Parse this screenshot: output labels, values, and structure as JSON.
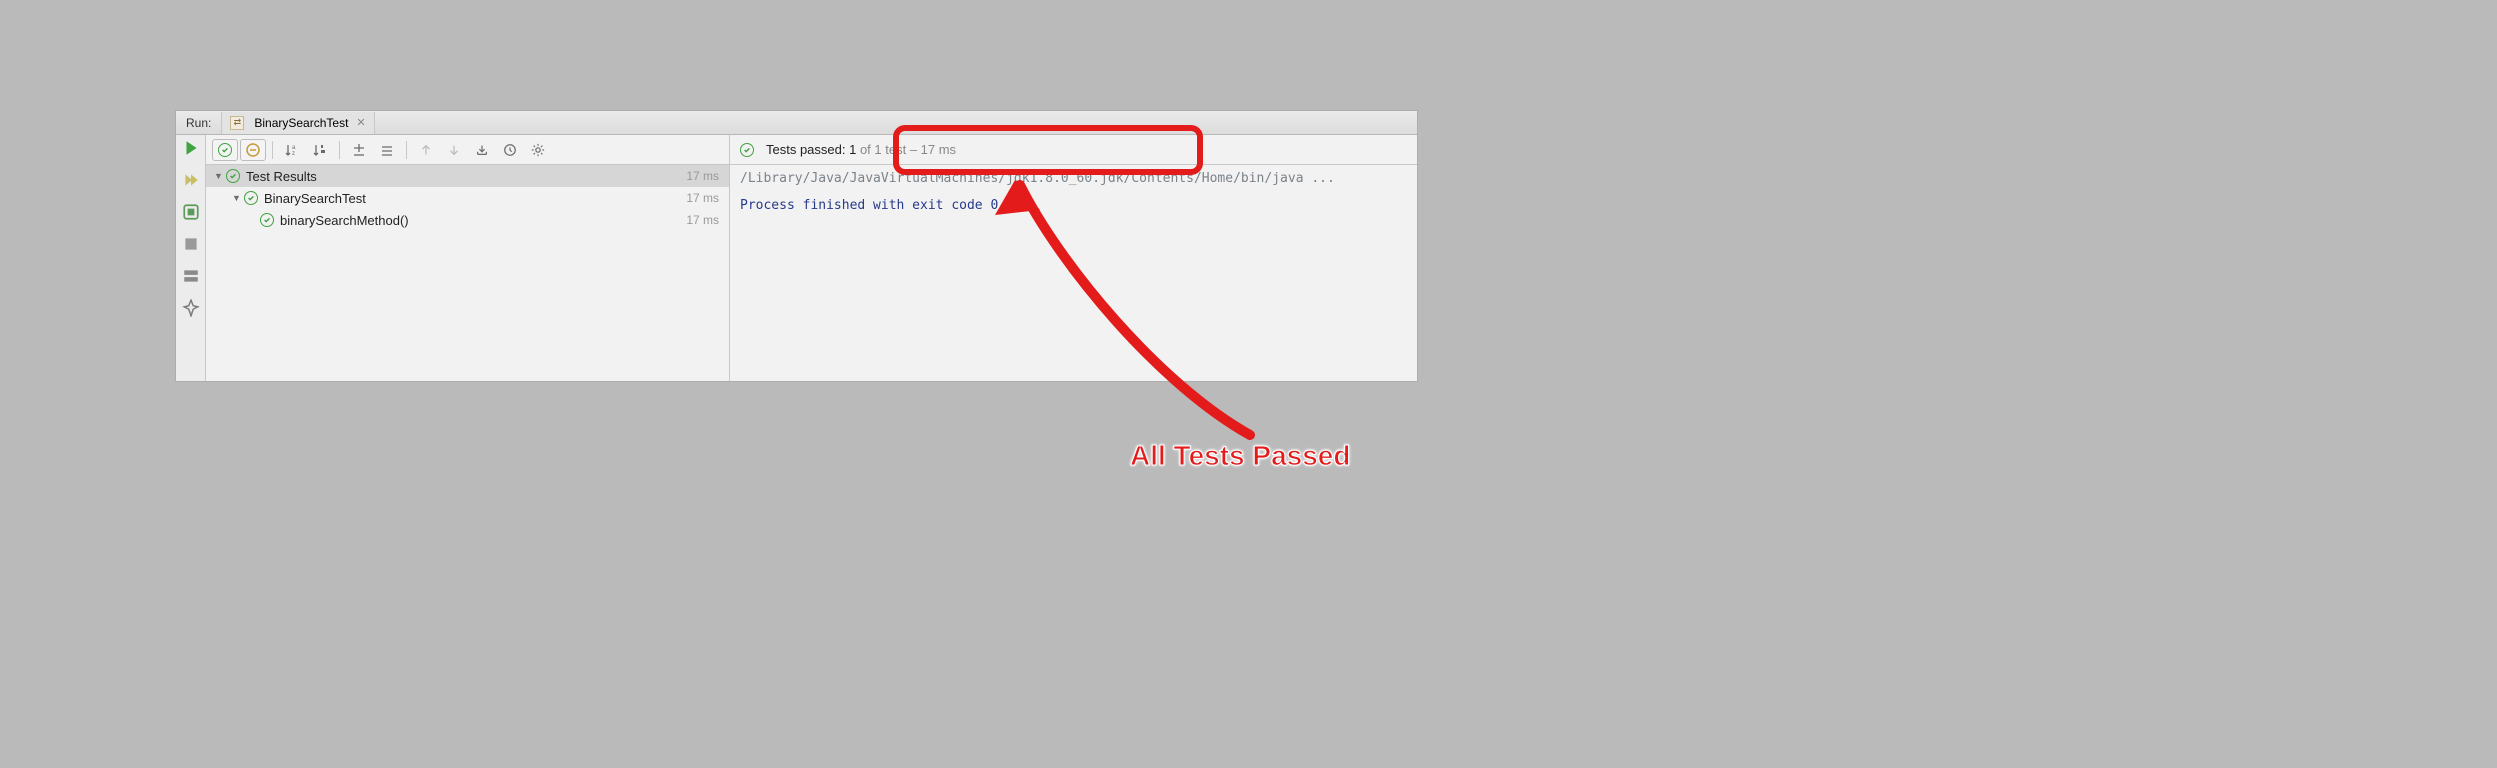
{
  "header": {
    "run_label": "Run:",
    "tab_name": "BinarySearchTest"
  },
  "status": {
    "prefix": "Tests passed: ",
    "passed_count": "1",
    "suffix": " of 1 test – 17 ms"
  },
  "tree": {
    "root": {
      "label": "Test Results",
      "time": "17 ms"
    },
    "class": {
      "label": "BinarySearchTest",
      "time": "17 ms"
    },
    "method": {
      "label": "binarySearchMethod()",
      "time": "17 ms"
    }
  },
  "console": {
    "line1": "/Library/Java/JavaVirtualMachines/jdk1.8.0_60.jdk/Contents/Home/bin/java ...",
    "line2": "Process finished with exit code 0"
  },
  "annotation": {
    "label": "All Tests Passed"
  }
}
